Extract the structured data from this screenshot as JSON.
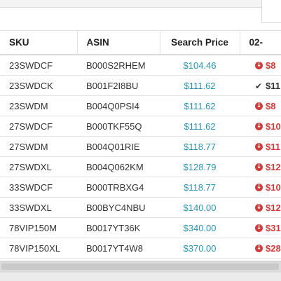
{
  "table": {
    "columns": [
      "SKU",
      "ASIN",
      "Search Price",
      "02-"
    ],
    "rows": [
      {
        "sku": "23SWDCF",
        "asin": "B000S2RHEM",
        "price": "$104.46",
        "change": "$8",
        "trend": "down"
      },
      {
        "sku": "23SWDCK",
        "asin": "B001F2I8BU",
        "price": "$111.62",
        "change": "$11",
        "trend": "check"
      },
      {
        "sku": "23SWDM",
        "asin": "B004Q0PSI4",
        "price": "$111.62",
        "change": "$8",
        "trend": "down"
      },
      {
        "sku": "27SWDCF",
        "asin": "B000TKF55Q",
        "price": "$111.62",
        "change": "$10",
        "trend": "down"
      },
      {
        "sku": "27SWDM",
        "asin": "B004Q01RIE",
        "price": "$118.77",
        "change": "$11",
        "trend": "down"
      },
      {
        "sku": "27SWDXL",
        "asin": "B004Q062KM",
        "price": "$128.79",
        "change": "$12",
        "trend": "down"
      },
      {
        "sku": "33SWDCF",
        "asin": "B000TRBXG4",
        "price": "$118.77",
        "change": "$10",
        "trend": "down"
      },
      {
        "sku": "33SWDXL",
        "asin": "B00BYC4NBU",
        "price": "$140.00",
        "change": "$12",
        "trend": "down"
      },
      {
        "sku": "78VIP150M",
        "asin": "B0017YT36K",
        "price": "$340.00",
        "change": "$31",
        "trend": "down"
      },
      {
        "sku": "78VIP150XL",
        "asin": "B0017YT4W8",
        "price": "$370.00",
        "change": "$28",
        "trend": "down"
      }
    ]
  },
  "icons": {
    "down": "arrow-down-circle-icon",
    "check": "check-icon"
  },
  "colors": {
    "price": "#2a92ad",
    "down": "#d23a3a",
    "check": "#333333"
  }
}
